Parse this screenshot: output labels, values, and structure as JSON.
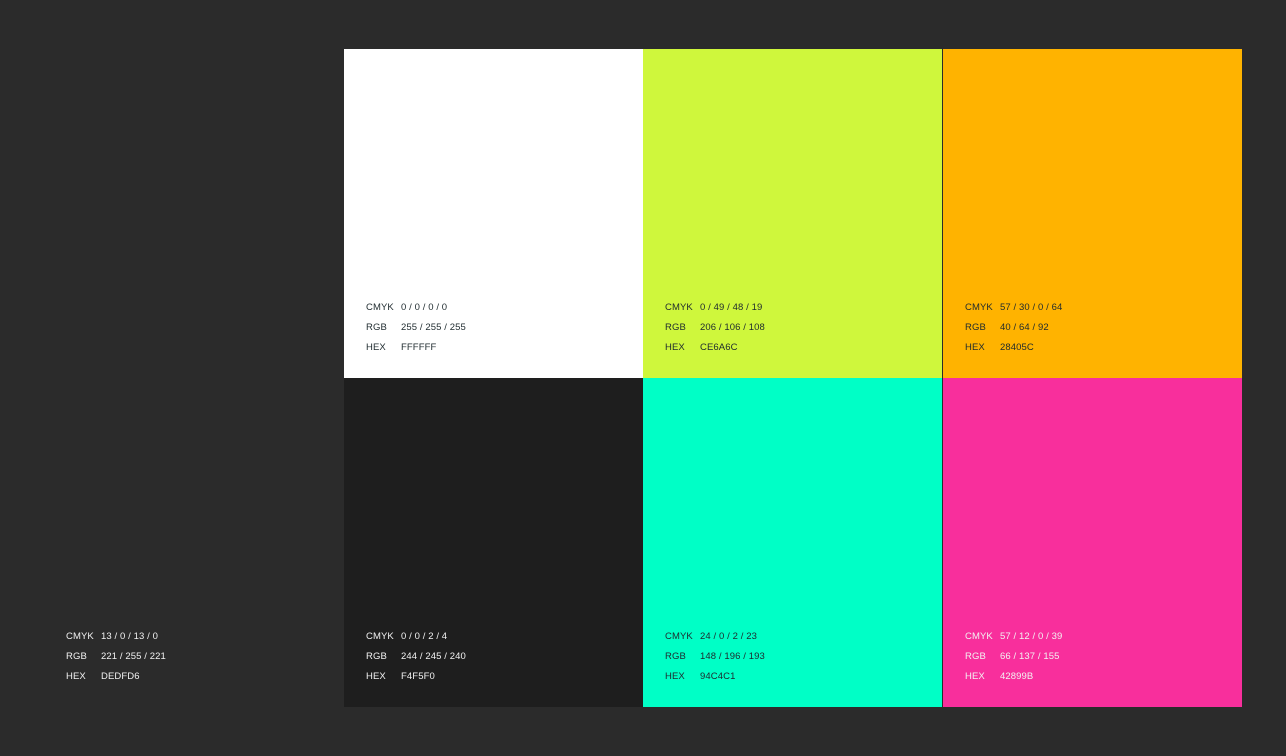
{
  "labels": {
    "cmyk": "CMYK",
    "rgb": "RGB",
    "hex": "HEX"
  },
  "background_color": "#2b2b2b",
  "standalone": {
    "cmyk": "13 / 0 / 13 / 0",
    "rgb": "221 / 255 / 221",
    "hex": "DEDFD6"
  },
  "swatches": [
    {
      "fill": "#ffffff",
      "cmyk": "0 / 0 / 0 / 0",
      "rgb": "255 / 255 / 255",
      "hex": "FFFFFF"
    },
    {
      "fill": "#cff73c",
      "cmyk": "0 / 49 / 48 / 19",
      "rgb": "206 / 106 / 108",
      "hex": "CE6A6C"
    },
    {
      "fill": "#ffb300",
      "cmyk": "57 / 30 / 0 / 64",
      "rgb": "40 / 64 / 92",
      "hex": "28405C"
    },
    {
      "fill": "#1e1e1e",
      "cmyk": "0 / 0 / 2 / 4",
      "rgb": "244 / 245 / 240",
      "hex": "F4F5F0"
    },
    {
      "fill": "#00ffc6",
      "cmyk": "24 / 0 / 2 / 23",
      "rgb": "148 / 196 / 193",
      "hex": "94C4C1"
    },
    {
      "fill": "#f82f9c",
      "cmyk": "57 / 12 / 0 / 39",
      "rgb": "66 / 137 / 155",
      "hex": "42899B"
    }
  ]
}
